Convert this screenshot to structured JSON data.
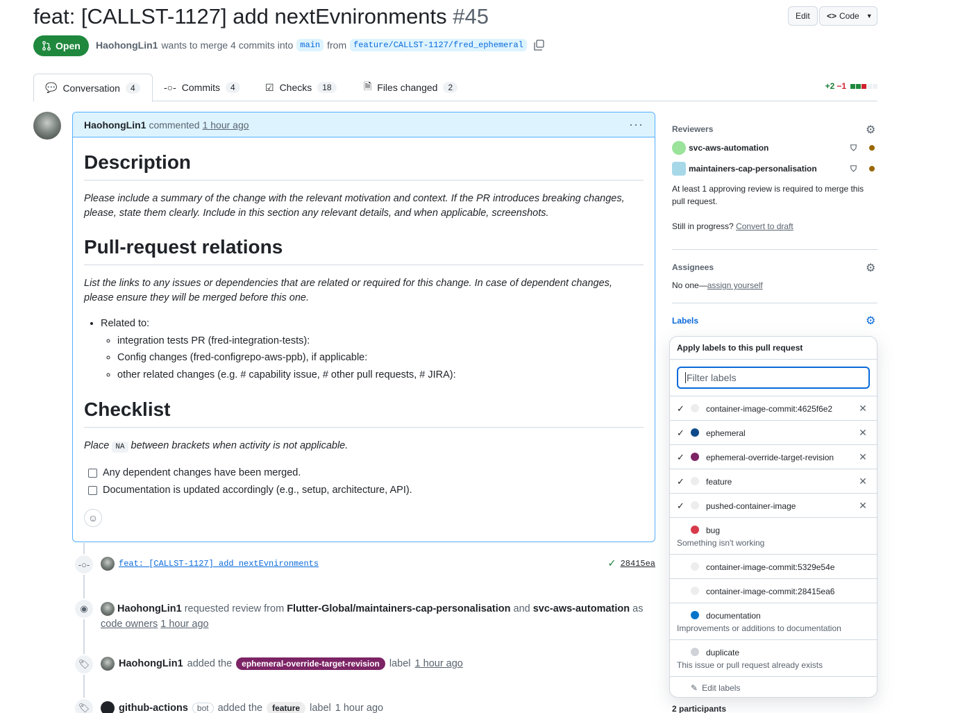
{
  "pr": {
    "title": "feat: [CALLST-1127] add nextEvnironments",
    "number": "#45",
    "state": "Open",
    "author": "HaohongLin1",
    "merge_text": "wants to merge 4 commits into",
    "base_branch": "main",
    "from_text": "from",
    "head_branch": "feature/CALLST-1127/fred_ephemeral"
  },
  "header": {
    "edit_label": "Edit",
    "code_label": "Code"
  },
  "tabs": [
    {
      "label": "Conversation",
      "count": "4"
    },
    {
      "label": "Commits",
      "count": "4"
    },
    {
      "label": "Checks",
      "count": "18"
    },
    {
      "label": "Files changed",
      "count": "2"
    }
  ],
  "diffstat": {
    "additions": "+2",
    "deletions": "−1"
  },
  "comment": {
    "author": "HaohongLin1",
    "action": "commented",
    "time": "1 hour ago",
    "h_description": "Description",
    "p_description": "Please include a summary of the change with the relevant motivation and context. If the PR introduces breaking changes, please, state them clearly. Include in this section any relevant details, and when applicable, screenshots.",
    "h_relations": "Pull-request relations",
    "p_relations": "List the links to any issues or dependencies that are related or required for this change. In case of dependent changes, please ensure they will be merged before this one.",
    "related_to": "Related to:",
    "related_items": [
      "integration tests PR (fred-integration-tests):",
      "Config changes (fred-configrepo-aws-ppb), if applicable:",
      "other related changes (e.g. # capability issue, # other pull requests, # JIRA):"
    ],
    "h_checklist": "Checklist",
    "checklist_pre": "Place",
    "checklist_code": "NA",
    "checklist_post": "between brackets when activity is not applicable.",
    "tasks": [
      "Any dependent changes have been merged.",
      "Documentation is updated accordingly (e.g., setup, architecture, API)."
    ]
  },
  "timeline": {
    "commit_msg": "feat: [CALLST-1127] add nextEvnironments",
    "commit_sha": "28415ea",
    "review_user": "HaohongLin1",
    "review_text1": "requested review from",
    "review_team": "Flutter-Global/maintainers-cap-personalisation",
    "review_and": "and",
    "review_bot": "svc-aws-automation",
    "review_as": "as",
    "review_owners": "code owners",
    "review_time": "1 hour ago",
    "label_user": "HaohongLin1",
    "label_added": "added the",
    "label_name": "ephemeral-override-target-revision",
    "label_word": "label",
    "label_time": "1 hour ago",
    "gh_user": "github-actions",
    "gh_bot": "bot",
    "gh_added": "added the",
    "gh_label": "feature",
    "gh_label_word": "label",
    "gh_time": "1 hour ago"
  },
  "sidebar": {
    "reviewers_h": "Reviewers",
    "reviewers": [
      "svc-aws-automation",
      "maintainers-cap-personalisation"
    ],
    "review_required": "At least 1 approving review is required to merge this pull request.",
    "in_progress": "Still in progress?",
    "convert_draft": "Convert to draft",
    "assignees_h": "Assignees",
    "no_one": "No one—",
    "assign_yourself": "assign yourself",
    "labels_h": "Labels",
    "participants": "2 participants"
  },
  "label_popup": {
    "header": "Apply labels to this pull request",
    "placeholder": "Filter labels",
    "edit_labels": "Edit labels",
    "items": [
      {
        "name": "container-image-commit:4625f6e2",
        "color": "#ededed",
        "checked": true,
        "desc": ""
      },
      {
        "name": "ephemeral",
        "color": "#0e4a8a",
        "checked": true,
        "desc": ""
      },
      {
        "name": "ephemeral-override-target-revision",
        "color": "#7c2465",
        "checked": true,
        "desc": ""
      },
      {
        "name": "feature",
        "color": "#ededed",
        "checked": true,
        "desc": ""
      },
      {
        "name": "pushed-container-image",
        "color": "#ededed",
        "checked": true,
        "desc": ""
      },
      {
        "name": "bug",
        "color": "#d73a4a",
        "checked": false,
        "desc": "Something isn't working"
      },
      {
        "name": "container-image-commit:5329e54e",
        "color": "#ededed",
        "checked": false,
        "desc": ""
      },
      {
        "name": "container-image-commit:28415ea6",
        "color": "#ededed",
        "checked": false,
        "desc": ""
      },
      {
        "name": "documentation",
        "color": "#0075ca",
        "checked": false,
        "desc": "Improvements or additions to documentation"
      },
      {
        "name": "duplicate",
        "color": "#cfd3d7",
        "checked": false,
        "desc": "This issue or pull request already exists"
      }
    ]
  }
}
